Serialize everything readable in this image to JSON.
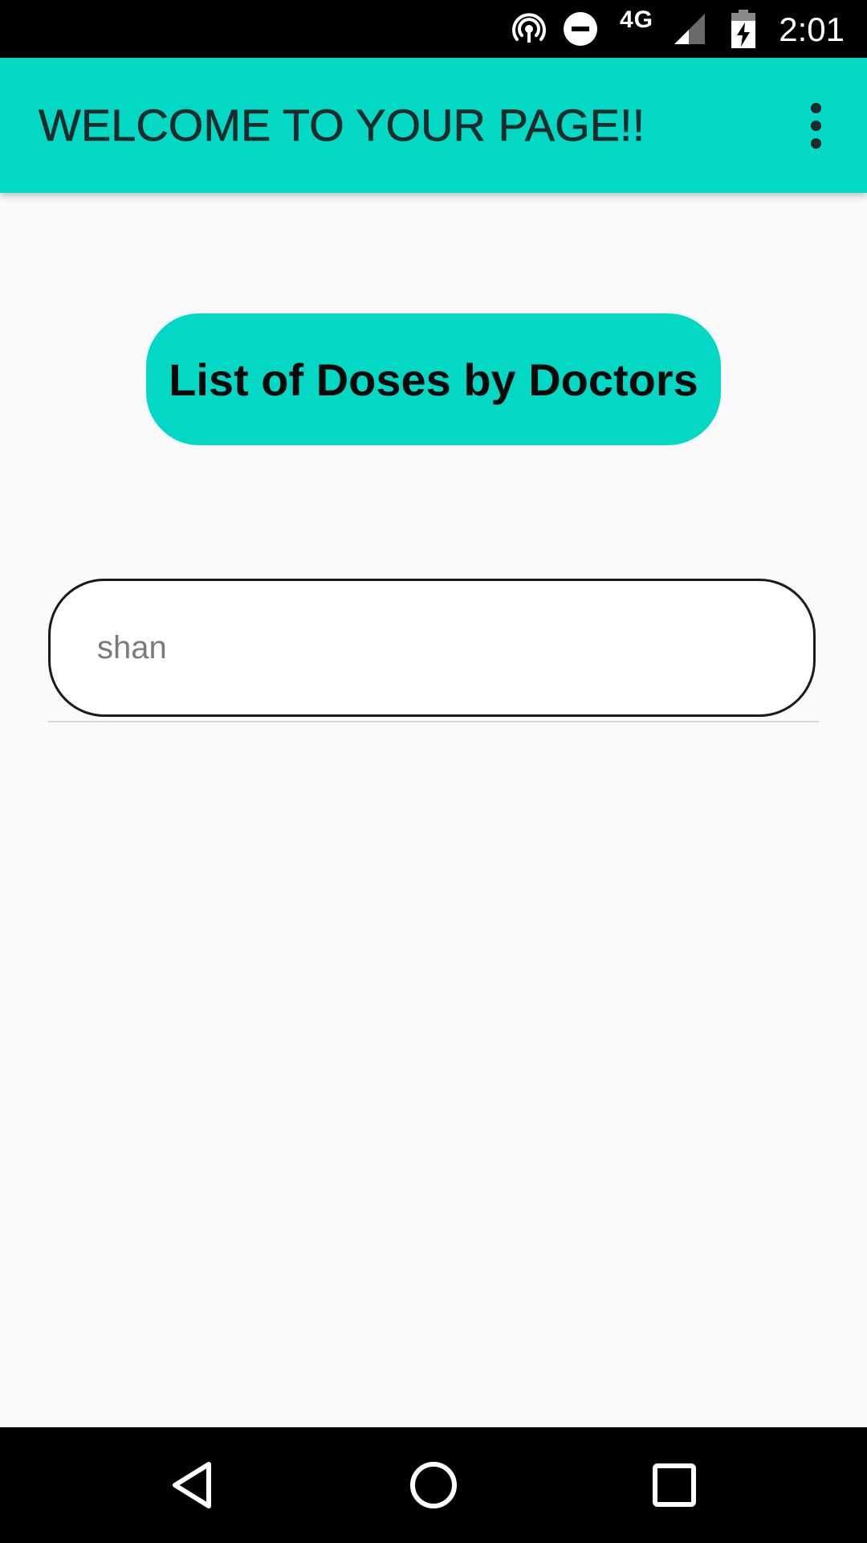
{
  "status_bar": {
    "time": "2:01",
    "network_type": "4G",
    "icons": [
      "hotspot-icon",
      "do-not-disturb-icon",
      "signal-icon",
      "battery-charging-icon"
    ]
  },
  "app_bar": {
    "title": "WELCOME TO YOUR PAGE!!",
    "menu_icon": "more-vert-icon",
    "background_color": "#03d8c5"
  },
  "main": {
    "doses_button_label": "List of Doses by Doctors",
    "name_field": {
      "value": "",
      "placeholder": "shan"
    }
  },
  "nav_bar": {
    "icons": [
      "back-icon",
      "home-icon",
      "recents-icon"
    ]
  },
  "colors": {
    "accent": "#03d8c5",
    "background": "#fafafa",
    "text_dark": "#1f2a2a"
  }
}
